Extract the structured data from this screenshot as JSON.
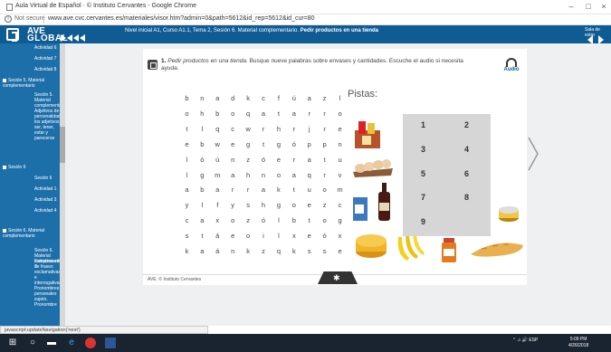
{
  "browser": {
    "window_title": "Aula Virtual de Español · © Instituto Cervantes - Google Chrome",
    "security_label": "Not secure",
    "url": "www.ave.cvc.cervantes.es/materiales/visor.htm?admin=0&path=5612&id_rep=5612&id_cur=80",
    "status_text": "javascript:updateNavigation('next')"
  },
  "app": {
    "name_line1": "AVE",
    "name_line2": "GLOBAL",
    "breadcrumb": "Nivel inicial A1, Curso A1.1, Tema 2, Sesión 6. Material complementario.",
    "breadcrumb_current": "Pedir productos en una tienda",
    "exit_label": "Sala de estar"
  },
  "sidebar": {
    "items": [
      {
        "label": "Actividad 6",
        "kind": "sub"
      },
      {
        "label": "Actividad 7",
        "kind": "sub"
      },
      {
        "label": "Actividad 8",
        "kind": "sub"
      },
      {
        "label": "Sesión 5. Material complementario",
        "kind": "section"
      },
      {
        "label": "Sesión 5. Material complementario. Adjetivos de personalidad, los adjetivos ser, tener, estar y parecerse",
        "kind": "sub"
      },
      {
        "label": "Sesión 6",
        "kind": "section"
      },
      {
        "label": "Sesión 6",
        "kind": "sub"
      },
      {
        "label": "Actividad 1",
        "kind": "sub"
      },
      {
        "label": "Actividad 3",
        "kind": "sub"
      },
      {
        "label": "Actividad 4",
        "kind": "sub"
      },
      {
        "label": "Sesión 6. Material complementario",
        "kind": "section"
      },
      {
        "label": "Sesión 6. Material complementario. 1",
        "kind": "sub"
      },
      {
        "label": "Estructuración de frases exclamativas e interrogativas. Pronombres personales sujeto. Pronombre",
        "kind": "sub"
      }
    ]
  },
  "exercise": {
    "number": "1.",
    "instruction_italic": "Pedir productos en una tienda.",
    "instruction_rest": "Busque nueve palabras sobre envases y cantidades. Escuche el audio si necesita ayuda.",
    "audio_label": "Audio",
    "pistas_label": "Pistas:",
    "grid": [
      [
        "b",
        "n",
        "a",
        "d",
        "k",
        "c",
        "f",
        "ú",
        "a",
        "z",
        "l"
      ],
      [
        "o",
        "h",
        "b",
        "o",
        "q",
        "a",
        "t",
        "a",
        "r",
        "r",
        "o"
      ],
      [
        "t",
        "l",
        "q",
        "c",
        "w",
        "r",
        "h",
        "r",
        "j",
        "r",
        "e"
      ],
      [
        "e",
        "b",
        "w",
        "e",
        "g",
        "t",
        "g",
        "ó",
        "p",
        "p",
        "n"
      ],
      [
        "l",
        "ó",
        "ú",
        "n",
        "z",
        "ó",
        "e",
        "r",
        "a",
        "t",
        "u"
      ],
      [
        "l",
        "g",
        "m",
        "a",
        "h",
        "n",
        "o",
        "a",
        "q",
        "r",
        "v"
      ],
      [
        "a",
        "b",
        "a",
        "r",
        "r",
        "a",
        "k",
        "t",
        "u",
        "o",
        "m"
      ],
      [
        "y",
        "l",
        "f",
        "y",
        "s",
        "h",
        "g",
        "o",
        "e",
        "z",
        "c"
      ],
      [
        "c",
        "a",
        "x",
        "o",
        "z",
        "ó",
        "l",
        "b",
        "t",
        "o",
        "g"
      ],
      [
        "s",
        "t",
        "á",
        "e",
        "o",
        "i",
        "l",
        "x",
        "e",
        "ó",
        "x"
      ],
      [
        "k",
        "a",
        "á",
        "n",
        "k",
        "z",
        "q",
        "k",
        "s",
        "s",
        "e"
      ]
    ],
    "numbers": [
      "1",
      "2",
      "3",
      "4",
      "5",
      "6",
      "7",
      "8",
      "9"
    ]
  },
  "footer": {
    "copyright": "AVE. © Instituto Cervantes"
  },
  "taskbar": {
    "language": "ESP",
    "time": "5:09 PM",
    "date": "4/26/2018"
  },
  "colors": {
    "nav_blue": "#0f5b93",
    "sidebar_blue": "#1d6fa9",
    "taskbar": "#1a2430"
  }
}
